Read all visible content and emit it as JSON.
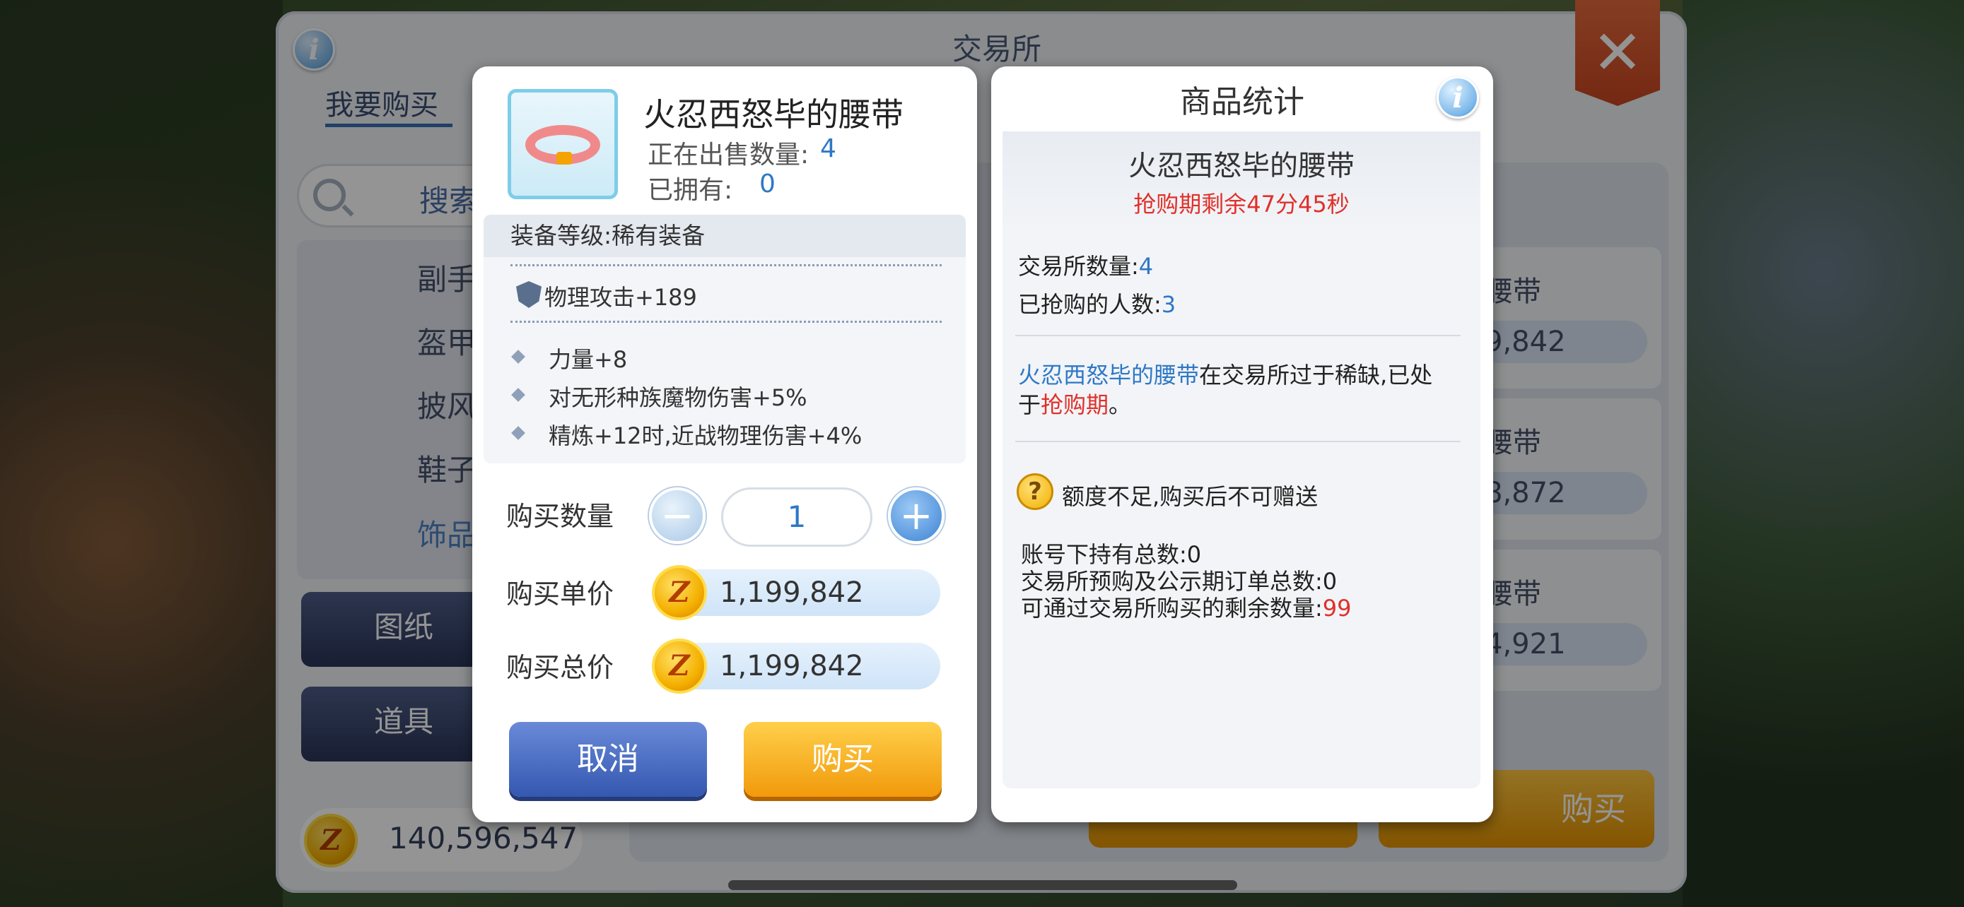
{
  "window": {
    "title": "交易所",
    "close_glyph": "✕",
    "info_glyph": "i"
  },
  "tabs": [
    {
      "label": "我要购买",
      "active": true
    }
  ],
  "search": {
    "label": "搜索",
    "icon": "search-icon"
  },
  "categories": [
    "副手",
    "盔甲",
    "披风",
    "鞋子",
    "饰品"
  ],
  "selected_category": "饰品",
  "side_buttons": [
    "图纸",
    "道具"
  ],
  "balance": {
    "coin_glyph": "Z",
    "amount": "140,596,547"
  },
  "background_list": [
    {
      "name": "腰带",
      "price": "9,842"
    },
    {
      "name": "腰带",
      "price": "8,872"
    },
    {
      "name": "腰带",
      "price": "4,921"
    }
  ],
  "background_buy_label": "购买",
  "purchase_dialog": {
    "item_name": "火忍西怒毕的腰带",
    "on_sale_label": "正在出售数量:",
    "on_sale_value": "4",
    "owned_label": "已拥有:",
    "owned_value": "0",
    "equip_level": "装备等级:稀有装备",
    "main_attr": "物理攻击+189",
    "sub_attrs": [
      "力量+8",
      "对无形种族魔物伤害+5%",
      "精炼+12时,近战物理伤害+4%"
    ],
    "qty_label": "购买数量",
    "qty_value": "1",
    "minus_glyph": "−",
    "plus_glyph": "+",
    "unit_price_label": "购买单价",
    "unit_price_value": "1,199,842",
    "total_price_label": "购买总价",
    "total_price_value": "1,199,842",
    "cancel_label": "取消",
    "buy_label": "购买"
  },
  "stats_dialog": {
    "title": "商品统计",
    "item_name": "火忍西怒毕的腰带",
    "timer": "抢购期剩余47分45秒",
    "exchange_qty_label": "交易所数量:",
    "exchange_qty_value": "4",
    "buyers_label": "已抢购的人数:",
    "buyers_value": "3",
    "notice_item": "火忍西怒毕的腰带",
    "notice_text1": "在交易所过于稀缺,已处",
    "notice_text2": "于",
    "notice_highlight": "抢购期",
    "notice_text3": "。",
    "warning_glyph": "?",
    "warning": "额度不足,购买后不可赠送",
    "account_total_label": "账号下持有总数:",
    "account_total_value": "0",
    "preorder_label": "交易所预购及公示期订单总数:",
    "preorder_value": "0",
    "remaining_label": "可通过交易所购买的剩余数量:",
    "remaining_value": "99"
  },
  "colors": {
    "accent_blue": "#2e78c6",
    "alert_red": "#e0302a",
    "buy_orange": "#f19a0c",
    "cancel_blue": "#3458b0"
  }
}
